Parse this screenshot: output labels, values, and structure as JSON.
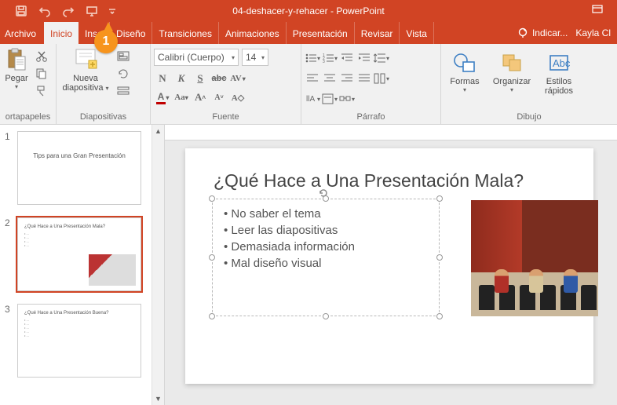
{
  "app": {
    "title": "04-deshacer-y-rehacer - PowerPoint",
    "tell_me": "Indicar...",
    "user": "Kayla Cl"
  },
  "callout": {
    "num": "1"
  },
  "tabs": {
    "file": "Archivo",
    "home": "Inicio",
    "insert": "Insertar",
    "design": "Diseño",
    "transitions": "Transiciones",
    "animations": "Animaciones",
    "slideshow": "Presentación",
    "review": "Revisar",
    "view": "Vista"
  },
  "ribbon": {
    "clipboard": {
      "paste": "Pegar",
      "group": "ortapapeles"
    },
    "slides": {
      "new_slide": "Nueva diapositiva",
      "group": "Diapositivas"
    },
    "font": {
      "name": "Calibri (Cuerpo)",
      "size": "14",
      "group": "Fuente",
      "bold": "N",
      "italic": "K",
      "underline": "S"
    },
    "paragraph": {
      "group": "Párrafo"
    },
    "drawing": {
      "shapes": "Formas",
      "arrange": "Organizar",
      "styles_l1": "Estilos",
      "styles_l2": "rápidos",
      "group": "Dibujo"
    }
  },
  "thumbs": [
    {
      "num": "1",
      "title": "Tips para una Gran Presentación",
      "sub": ""
    },
    {
      "num": "2",
      "title": "¿Qué Hace a Una Presentación Mala?"
    },
    {
      "num": "3",
      "title": "¿Qué Hace a Una Presentación Buena?"
    }
  ],
  "slide": {
    "title": "¿Qué Hace a Una Presentación Mala?",
    "bullets": [
      "No saber el tema",
      "Leer las diapositivas",
      "Demasiada información",
      "Mal diseño visual"
    ]
  }
}
